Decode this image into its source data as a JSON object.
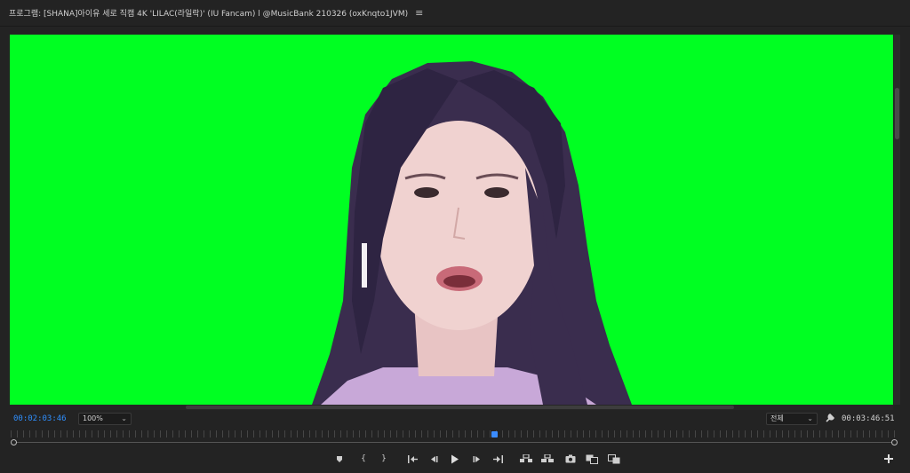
{
  "header": {
    "title": "프로그램: [SHANA]아이유 세로 직캠 4K 'LILAC(라일락)' (IU Fancam) l @MusicBank 210326 (oxKnqto1JVM)",
    "menu_icon": "hamburger-menu-icon"
  },
  "controls": {
    "current_timecode": "00:02:03:46",
    "zoom": "100%",
    "quality": "전체",
    "duration_timecode": "00:03:46:51"
  },
  "playback": {
    "position_fraction": 0.545
  },
  "transport": {
    "buttons": [
      {
        "name": "add-marker-button",
        "icon": "marker-icon"
      },
      {
        "name": "mark-in-button",
        "label": "{"
      },
      {
        "name": "mark-out-button",
        "label": "}"
      },
      {
        "name": "go-to-in-button",
        "icon": "go-to-in-icon"
      },
      {
        "name": "step-back-button",
        "icon": "step-back-icon"
      },
      {
        "name": "play-button",
        "icon": "play-icon"
      },
      {
        "name": "step-forward-button",
        "icon": "step-forward-icon"
      },
      {
        "name": "go-to-out-button",
        "icon": "go-to-out-icon"
      },
      {
        "name": "lift-button",
        "icon": "lift-icon"
      },
      {
        "name": "extract-button",
        "icon": "extract-icon"
      },
      {
        "name": "export-frame-button",
        "icon": "camera-icon"
      },
      {
        "name": "compare-view-button",
        "icon": "compare-icon"
      },
      {
        "name": "toggle-proxies-button",
        "icon": "proxy-icon"
      },
      {
        "name": "button-editor",
        "icon": "plus-icon"
      }
    ]
  },
  "colors": {
    "background": "#232323",
    "green_screen": "#00ff22",
    "accent_blue": "#2f8fff"
  }
}
